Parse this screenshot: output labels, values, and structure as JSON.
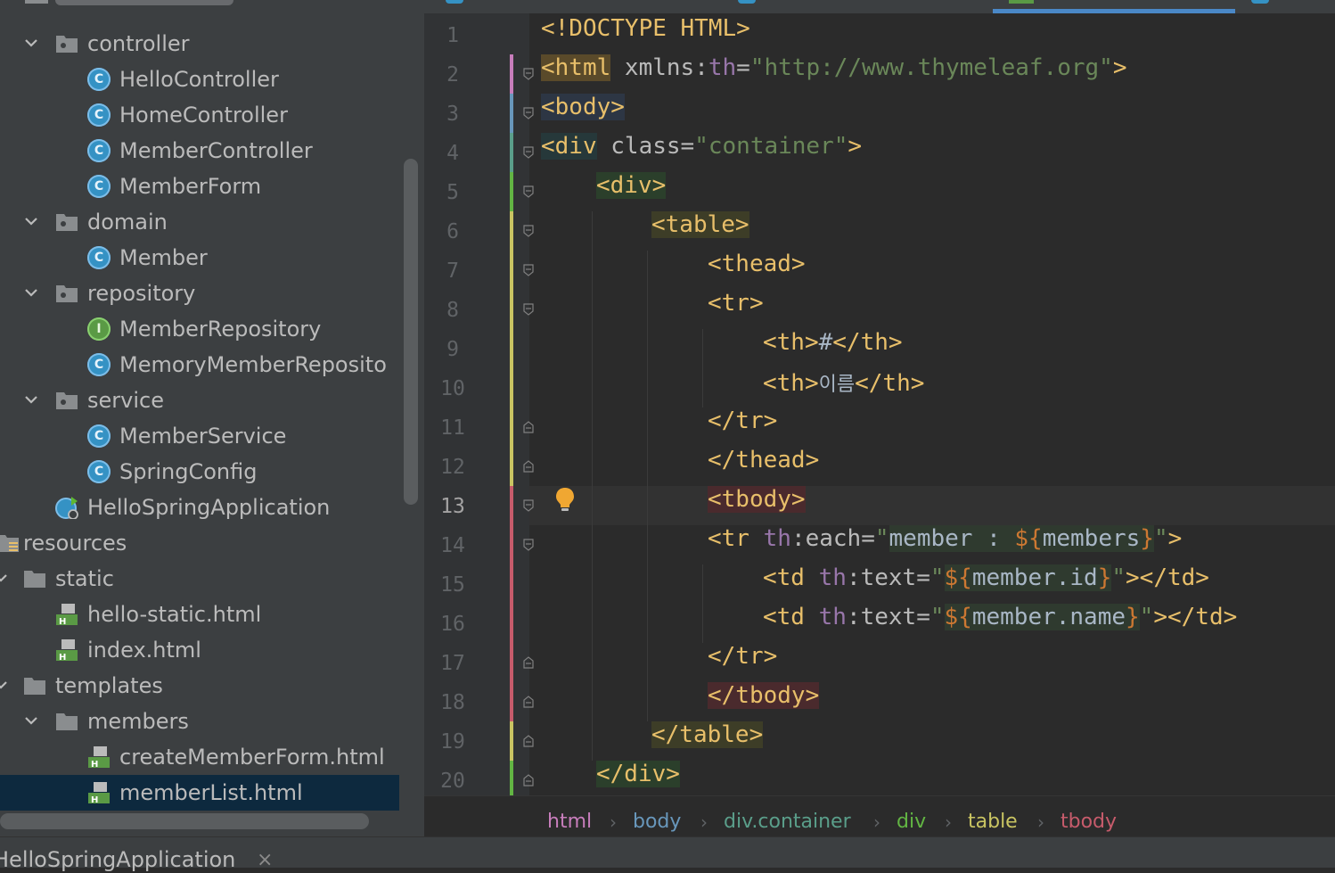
{
  "project_tree": {
    "items": [
      {
        "label": "controller",
        "type": "package"
      },
      {
        "label": "HelloController",
        "type": "class"
      },
      {
        "label": "HomeController",
        "type": "class"
      },
      {
        "label": "MemberController",
        "type": "class"
      },
      {
        "label": "MemberForm",
        "type": "class"
      },
      {
        "label": "domain",
        "type": "package"
      },
      {
        "label": "Member",
        "type": "class"
      },
      {
        "label": "repository",
        "type": "package"
      },
      {
        "label": "MemberRepository",
        "type": "interface"
      },
      {
        "label": "MemoryMemberReposito",
        "type": "class"
      },
      {
        "label": "service",
        "type": "package"
      },
      {
        "label": "MemberService",
        "type": "class"
      },
      {
        "label": "SpringConfig",
        "type": "class"
      },
      {
        "label": "HelloSpringApplication",
        "type": "spring-boot-class"
      },
      {
        "label": "resources",
        "type": "resources-folder"
      },
      {
        "label": "static",
        "type": "folder"
      },
      {
        "label": "hello-static.html",
        "type": "html-file"
      },
      {
        "label": "index.html",
        "type": "html-file"
      },
      {
        "label": "templates",
        "type": "folder"
      },
      {
        "label": "members",
        "type": "folder"
      },
      {
        "label": "createMemberForm.html",
        "type": "html-file"
      },
      {
        "label": "memberList.html",
        "type": "html-file",
        "selected": true
      }
    ]
  },
  "editor": {
    "current_line": 13,
    "line_numbers": [
      "1",
      "2",
      "3",
      "4",
      "5",
      "6",
      "7",
      "8",
      "9",
      "10",
      "11",
      "12",
      "13",
      "14",
      "15",
      "16",
      "17",
      "18",
      "19",
      "20"
    ],
    "code": {
      "l1": {
        "t1": "<!DOCTYPE HTML>"
      },
      "l2": {
        "t1": "<html",
        "t2": " xmlns:",
        "t3": "th",
        "t4": "=",
        "t5": "\"http://www.thymeleaf.org\"",
        "t6": ">"
      },
      "l3": {
        "t1": "<body>"
      },
      "l4": {
        "t1": "<div",
        "t2": " class=",
        "t3": "\"container\"",
        "t4": ">"
      },
      "l5": {
        "t1": "<div>"
      },
      "l6": {
        "t1": "<table>"
      },
      "l7": {
        "t1": "<thead>"
      },
      "l8": {
        "t1": "<tr>"
      },
      "l9": {
        "t1": "<th>",
        "t2": "#",
        "t3": "</th>"
      },
      "l10": {
        "t1": "<th>",
        "t2": "이름",
        "t3": "</th>"
      },
      "l11": {
        "t1": "</tr>"
      },
      "l12": {
        "t1": "</thead>"
      },
      "l13": {
        "t1": "<tbody>"
      },
      "l14": {
        "t1": "<tr",
        "t2": " th",
        "t3": ":each=",
        "t4": "\"",
        "t5": "member : ",
        "t6": "${",
        "t7": "members",
        "t8": "}",
        "t9": "\"",
        "t10": ">"
      },
      "l15": {
        "t1": "<td",
        "t2": " th",
        "t3": ":text=",
        "t4": "\"",
        "t5": "${",
        "t6": "member.id",
        "t7": "}",
        "t8": "\"",
        "t9": "></td>"
      },
      "l16": {
        "t1": "<td",
        "t2": " th",
        "t3": ":text=",
        "t4": "\"",
        "t5": "${",
        "t6": "member.name",
        "t7": "}",
        "t8": "\"",
        "t9": "></td>"
      },
      "l17": {
        "t1": "</tr>"
      },
      "l18": {
        "t1": "</tbody>"
      },
      "l19": {
        "t1": "</table>"
      },
      "l20": {
        "t1": "</div>"
      }
    }
  },
  "breadcrumb": {
    "items": [
      "html",
      "body",
      "div.container",
      "div",
      "table",
      "tbody"
    ],
    "separator": "›"
  },
  "bottom_panel": {
    "tab_label": "HelloSpringApplication",
    "close_symbol": "×"
  },
  "colors": {
    "background": "#2b2b2b",
    "tag": "#e8bf6a",
    "string": "#6a8759",
    "namespace": "#9876aa",
    "expression": "#cc7832",
    "selection": "#0d293e",
    "accent": "#4a88c7"
  }
}
